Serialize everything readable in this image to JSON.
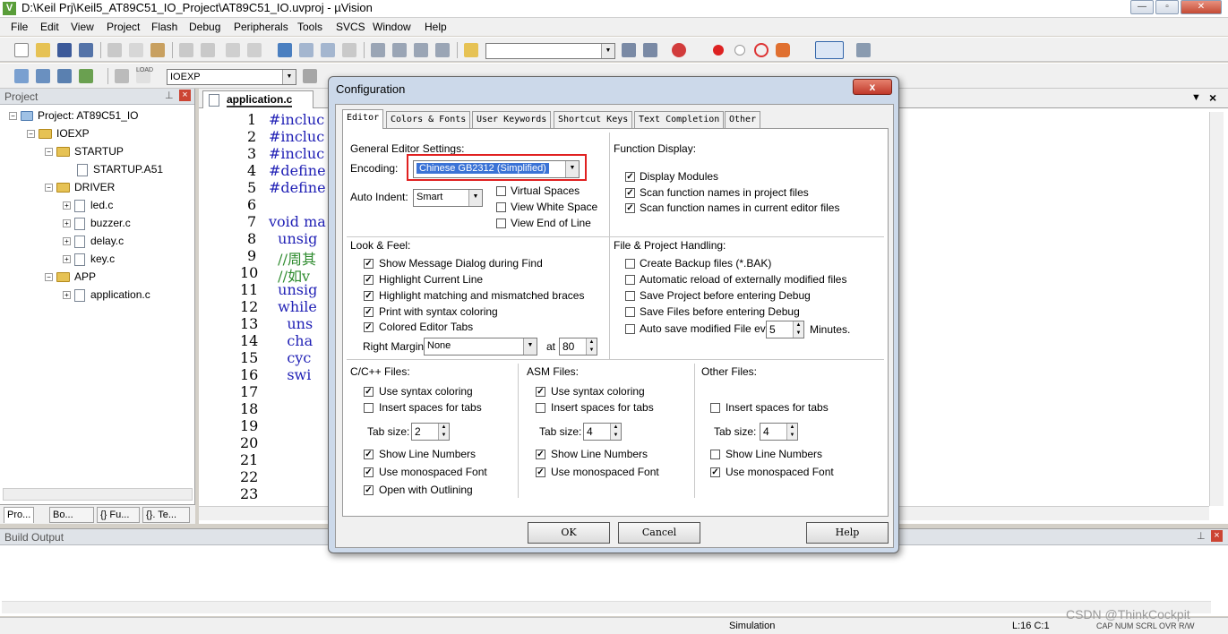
{
  "window": {
    "title": "D:\\Keil Prj\\Keil5_AT89C51_IO_Project\\AT89C51_IO.uvproj - µVision",
    "app_icon": "V",
    "controls": {
      "minimize": "—",
      "maximize": "▫",
      "close": "✕"
    }
  },
  "menu": [
    "File",
    "Edit",
    "View",
    "Project",
    "Flash",
    "Debug",
    "Peripherals",
    "Tools",
    "SVCS",
    "Window",
    "Help"
  ],
  "toolbar": {
    "target_combo": "IOEXP",
    "find_combo": "",
    "load_label": "LOAD"
  },
  "project_panel": {
    "header": "Project",
    "pin": "⊥",
    "close": "×",
    "root": "Project: AT89C51_IO",
    "target": "IOEXP",
    "groups": [
      {
        "name": "STARTUP",
        "files": [
          "STARTUP.A51"
        ]
      },
      {
        "name": "DRIVER",
        "files": [
          "led.c",
          "buzzer.c",
          "delay.c",
          "key.c"
        ]
      },
      {
        "name": "APP",
        "files": [
          "application.c"
        ]
      }
    ],
    "bottom_tabs": [
      "Pro...",
      "Bo...",
      "{} Fu...",
      "{}. Te..."
    ]
  },
  "editor": {
    "tab": "application.c",
    "line_numbers": [
      "1",
      "2",
      "3",
      "4",
      "5",
      "6",
      "7",
      "8",
      "9",
      "10",
      "11",
      "12",
      "13",
      "14",
      "15",
      "16",
      "17",
      "18",
      "19",
      "20",
      "21",
      "22",
      "23"
    ],
    "lines": [
      {
        "text": "#incluc",
        "comment": false
      },
      {
        "text": "#incluc",
        "comment": false
      },
      {
        "text": "#incluc",
        "comment": false
      },
      {
        "text": "#define",
        "comment": false
      },
      {
        "text": "#define",
        "comment": false
      },
      {
        "text": "",
        "comment": false
      },
      {
        "text": "void ma",
        "comment": false
      },
      {
        "text": "  unsig",
        "comment": false
      },
      {
        "text": "  //周其",
        "comment": true
      },
      {
        "text": "  //如v",
        "comment": true
      },
      {
        "text": "  unsig",
        "comment": false
      },
      {
        "text": "  while",
        "comment": false
      },
      {
        "text": "    uns",
        "comment": false
      },
      {
        "text": "    cha",
        "comment": false
      },
      {
        "text": "    cyc",
        "comment": false
      },
      {
        "text": "    swi",
        "comment": false
      }
    ]
  },
  "build_output": {
    "header": "Build Output"
  },
  "status": {
    "mode": "Simulation",
    "position": "L:16 C:1",
    "indicators": "CAP NUM SCRL OVR R/W",
    "watermark": "CSDN @ThinkCockpit"
  },
  "dialog": {
    "title": "Configuration",
    "close": "x",
    "tabs": [
      "Editor",
      "Colors & Fonts",
      "User Keywords",
      "Shortcut Keys",
      "Text Completion",
      "Other"
    ],
    "general": {
      "heading": "General Editor Settings:",
      "encoding_label": "Encoding:",
      "encoding_value": "Chinese GB2312 (Simplified)",
      "auto_indent_label": "Auto Indent:",
      "auto_indent_value": "Smart",
      "virtual_spaces": "Virtual Spaces",
      "view_white_space": "View White Space",
      "view_end_of_line": "View End of Line"
    },
    "function_display": {
      "heading": "Function Display:",
      "display_modules": "Display Modules",
      "scan_project": "Scan function names in project files",
      "scan_current": "Scan function names in current editor files"
    },
    "look_feel": {
      "heading": "Look & Feel:",
      "items": [
        "Show Message Dialog during Find",
        "Highlight Current Line",
        "Highlight matching and mismatched braces",
        "Print with syntax coloring",
        "Colored Editor Tabs"
      ],
      "right_margin_label": "Right Margin:",
      "right_margin_value": "None",
      "at_label": "at",
      "at_value": "80"
    },
    "file_project": {
      "heading": "File & Project Handling:",
      "items": [
        "Create Backup files (*.BAK)",
        "Automatic reload of externally modified files",
        "Save Project before entering Debug",
        "Save Files before entering Debug"
      ],
      "autosave_label": "Auto save modified File every",
      "autosave_value": "5",
      "minutes_label": "Minutes."
    },
    "cpp_files": {
      "heading": "C/C++ Files:",
      "syntax": "Use syntax coloring",
      "insert_spaces": "Insert spaces for tabs",
      "tab_size_label": "Tab size:",
      "tab_size": "2",
      "line_numbers": "Show Line Numbers",
      "monospaced": "Use monospaced Font",
      "outlining": "Open with Outlining"
    },
    "asm_files": {
      "heading": "ASM Files:",
      "syntax": "Use syntax coloring",
      "insert_spaces": "Insert spaces for tabs",
      "tab_size_label": "Tab size:",
      "tab_size": "4",
      "line_numbers": "Show Line Numbers",
      "monospaced": "Use monospaced Font"
    },
    "other_files": {
      "heading": "Other Files:",
      "insert_spaces": "Insert spaces for tabs",
      "tab_size_label": "Tab size:",
      "tab_size": "4",
      "line_numbers": "Show Line Numbers",
      "monospaced": "Use monospaced Font"
    },
    "buttons": {
      "ok": "OK",
      "cancel": "Cancel",
      "help": "Help"
    },
    "check": "✓",
    "highlight_color": "#e02020"
  }
}
